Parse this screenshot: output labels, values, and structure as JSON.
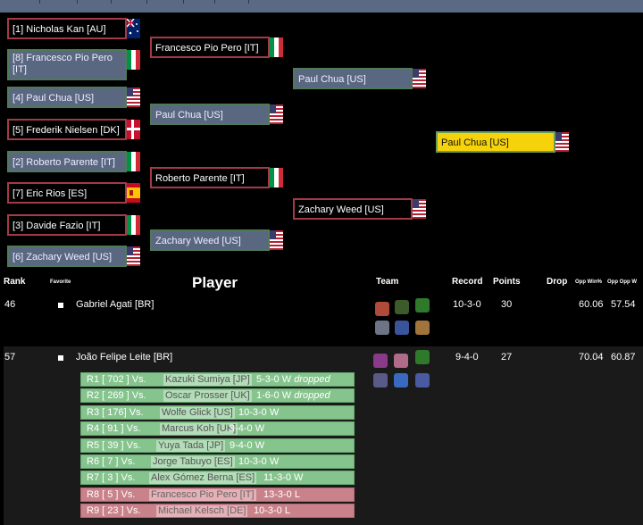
{
  "bracket": {
    "r1": [
      {
        "name": "[1] Nicholas Kan [AU]",
        "flag": "au",
        "state": "win"
      },
      {
        "name": "[8] Francesco Pio Pero [IT]",
        "flag": "it",
        "state": "lose"
      },
      {
        "name": "[4] Paul Chua [US]",
        "flag": "us",
        "state": "lose"
      },
      {
        "name": "[5] Frederik Nielsen [DK]",
        "flag": "dk",
        "state": "win"
      },
      {
        "name": "[2] Roberto Parente [IT]",
        "flag": "it",
        "state": "lose"
      },
      {
        "name": "[7] Eric Rios [ES]",
        "flag": "es",
        "state": "win"
      },
      {
        "name": "[3] Davide Fazio [IT]",
        "flag": "it",
        "state": "win"
      },
      {
        "name": "[6] Zachary Weed [US]",
        "flag": "us",
        "state": "lose"
      }
    ],
    "r2": [
      {
        "name": "Francesco Pio Pero [IT]",
        "flag": "it",
        "state": "win"
      },
      {
        "name": "Paul Chua [US]",
        "flag": "us",
        "state": "lose"
      },
      {
        "name": "Roberto Parente [IT]",
        "flag": "it",
        "state": "win"
      },
      {
        "name": "Zachary Weed [US]",
        "flag": "us",
        "state": "lose"
      }
    ],
    "r3": [
      {
        "name": "Paul Chua [US]",
        "flag": "us",
        "state": "lose"
      },
      {
        "name": "Zachary Weed [US]",
        "flag": "us",
        "state": "win"
      }
    ],
    "final": {
      "name": "Paul Chua [US]",
      "flag": "us"
    }
  },
  "table": {
    "headers": {
      "rank": "Rank",
      "favorite": "Favorite",
      "player": "Player",
      "team": "Team",
      "record": "Record",
      "points": "Points",
      "drop": "Drop",
      "oppwin": "Opp Win%",
      "oppopp": "Opp Opp W"
    },
    "rows": [
      {
        "rank": "46",
        "name": "Gabriel Agati [BR]",
        "record": "10-3-0",
        "points": "30",
        "opp": "60.06",
        "oppopp": "57.54"
      },
      {
        "rank": "57",
        "name": "João Felipe Leite [BR]",
        "record": "9-4-0",
        "points": "27",
        "opp": "70.04",
        "oppopp": "60.87"
      }
    ],
    "matches": [
      {
        "r": "R1 [ 702 ] Vs.",
        "opp": "Kazuki Sumiya [JP]",
        "res": "5-3-0 W",
        "drop": "dropped",
        "loss": false
      },
      {
        "r": "R2 [ 269 ] Vs.",
        "opp": "Oscar Prosser [UK]",
        "res": "1-6-0 W",
        "drop": "dropped",
        "loss": false
      },
      {
        "r": "R3 [ 176] Vs.",
        "opp": "Wolfe Glick [US]",
        "res": "10-3-0 W",
        "drop": "",
        "loss": false
      },
      {
        "r": "R4 [ 91 ] Vs.",
        "opp": "Marcus Koh [UK]",
        "res": "9-4-0 W",
        "drop": "",
        "loss": false
      },
      {
        "r": "R5 [ 39 ] Vs.",
        "opp": "Yuya Tada [JP]",
        "res": "9-4-0 W",
        "drop": "",
        "loss": false
      },
      {
        "r": "R6 [ 7 ] Vs.",
        "opp": "Jorge Tabuyo [ES]",
        "res": "10-3-0 W",
        "drop": "",
        "loss": false
      },
      {
        "r": "R7 [ 3 ] Vs.",
        "opp": "Alex Gómez Berna [ES]",
        "res": "11-3-0 W",
        "drop": "",
        "loss": false
      },
      {
        "r": "R8 [ 5 ] Vs.",
        "opp": "Francesco Pio Pero [IT]",
        "res": "13-3-0 L",
        "drop": "",
        "loss": true
      },
      {
        "r": "R9 [ 23 ] Vs.",
        "opp": "Michael Kelsch [DE]",
        "res": "10-3-0 L",
        "drop": "",
        "loss": true
      }
    ]
  }
}
